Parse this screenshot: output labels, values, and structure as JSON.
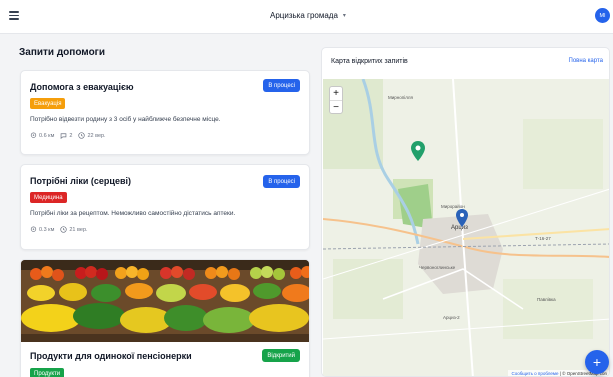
{
  "header": {
    "community": "Арцизька громада",
    "avatar_initials": "MI"
  },
  "requests": {
    "section_title": "Запити допомоги",
    "items": [
      {
        "title": "Допомога з евакуацією",
        "status": "В процесі",
        "category": "Евакуація",
        "description": "Потрібно відвезти родину з 3 осіб у найближче безпечне місце.",
        "distance": "0.6 км",
        "comments": "2",
        "date": "22 вер."
      },
      {
        "title": "Потрібні ліки (серцеві)",
        "status": "В процесі",
        "category": "Медицина",
        "description": "Потрібні ліки за рецептом. Неможливо самостійно дістатись аптеки.",
        "distance": "0.3 км",
        "date": "21 вер."
      },
      {
        "title": "Продукти для одинокої пенсіонерки",
        "status": "Відкритий",
        "category": "Продукти"
      }
    ]
  },
  "map": {
    "title": "Карта відкритих запитів",
    "full_link": "Повна карта",
    "zoom_in": "+",
    "zoom_out": "−",
    "labels": {
      "north": "Мирнопілля",
      "mid": "Мирорайон",
      "town": "Арциз",
      "road": "Т-16-27",
      "west": "Червоноглинське",
      "east": "Павлівка",
      "south": "Арциз-2"
    },
    "attribution_link": "Сообщить о проблеме",
    "attribution_text": "| © OpenStreetMap con"
  },
  "fab_label": "+",
  "colors": {
    "accent": "#2563eb",
    "evacuation": "#f59e0b",
    "medicine": "#dc2626",
    "food": "#16a34a",
    "open_status": "#16a34a"
  }
}
